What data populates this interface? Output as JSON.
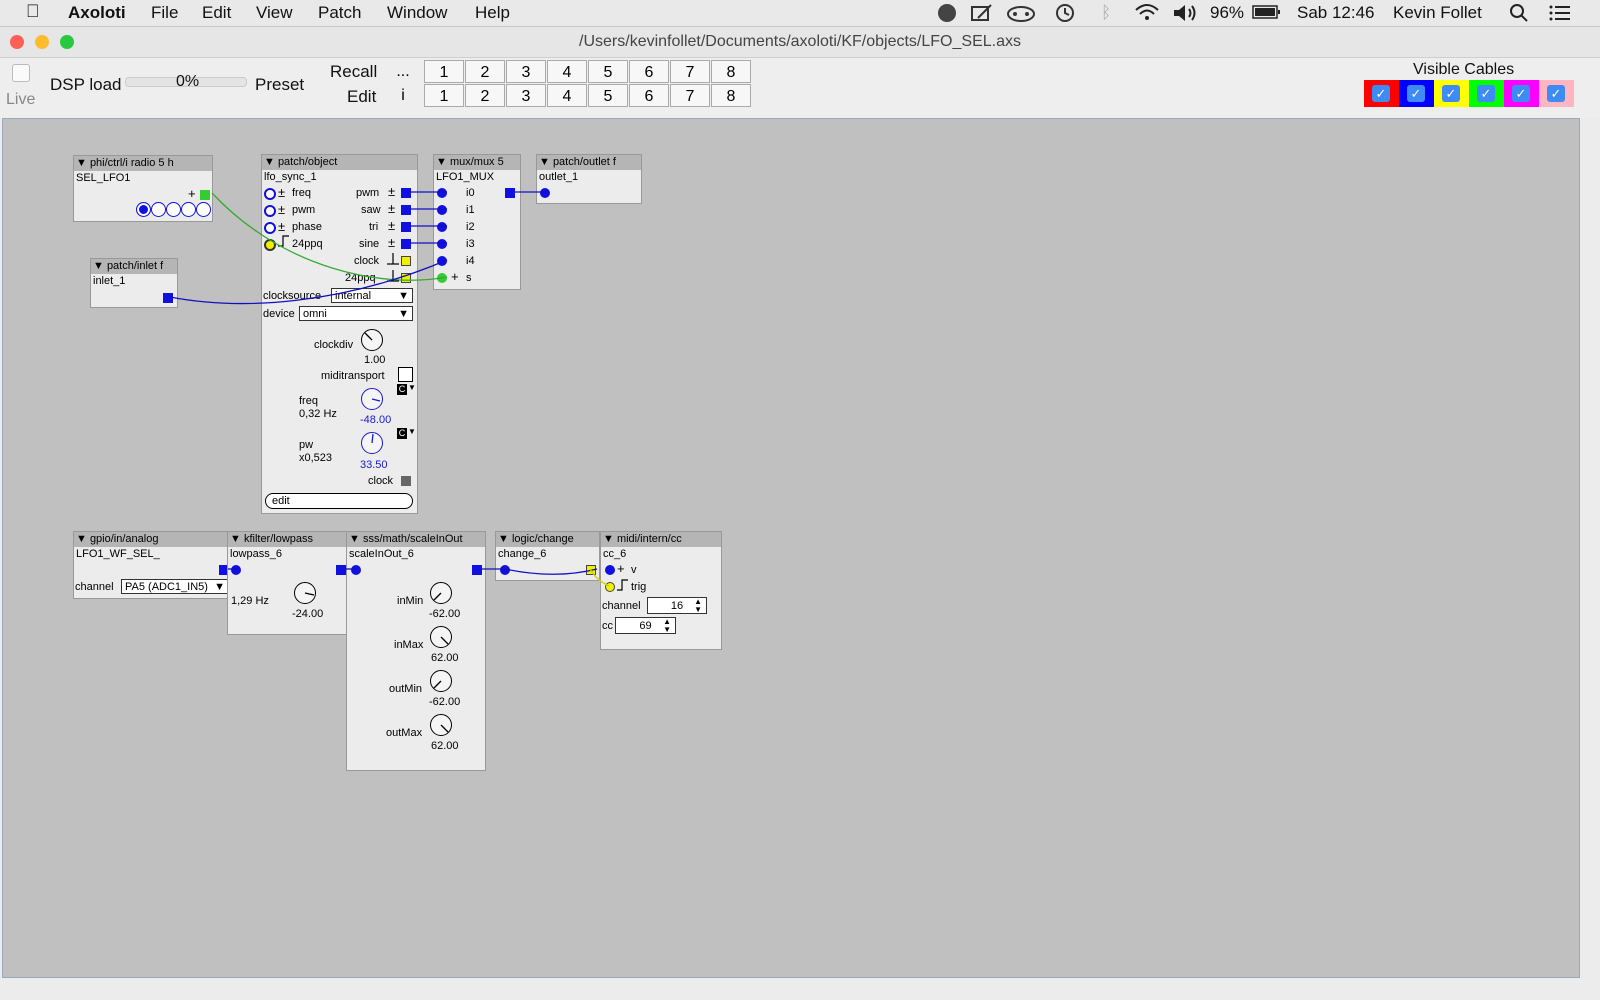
{
  "menubar": {
    "app": "Axoloti",
    "items": [
      "File",
      "Edit",
      "View",
      "Patch",
      "Window",
      "Help"
    ],
    "battery": "96%",
    "clock": "Sab 12:46",
    "user": "Kevin Follet"
  },
  "window": {
    "title": "/Users/kevinfollet/Documents/axoloti/KF/objects/LFO_SEL.axs"
  },
  "toolbar": {
    "live": "Live",
    "dsp_load": "DSP load",
    "dsp_value": "0%",
    "preset": "Preset",
    "recall": "Recall",
    "edit": "Edit",
    "recall_cells": [
      "...",
      "1",
      "2",
      "3",
      "4",
      "5",
      "6",
      "7",
      "8"
    ],
    "edit_cells": [
      "i",
      "1",
      "2",
      "3",
      "4",
      "5",
      "6",
      "7",
      "8"
    ],
    "visible_cables": "Visible Cables",
    "cable_colors": [
      "#ff0000",
      "#0000ff",
      "#ffff00",
      "#00ff00",
      "#ff00ff",
      "#ffb6c1"
    ],
    "check_mark": "✓"
  },
  "objects": {
    "radio": {
      "header": "▼ phi/ctrl/i radio 5 h",
      "instance": "SEL_LFO1",
      "plus": "+"
    },
    "inlet": {
      "header": "▼ patch/inlet f",
      "instance": "inlet_1"
    },
    "lfo": {
      "header": "▼ patch/object",
      "instance": "lfo_sync_1",
      "inputs": [
        "freq",
        "pwm",
        "phase",
        "24ppq"
      ],
      "outputs": [
        "pwm",
        "saw",
        "tri",
        "sine",
        "clock",
        "24ppq"
      ],
      "pm": "±",
      "clocksource_label": "clocksource",
      "clocksource_value": "internal",
      "device_label": "device",
      "device_value": "omni",
      "clockdiv_label": "clockdiv",
      "clockdiv_value": "1.00",
      "miditransport_label": "miditransport",
      "freq_label": "freq",
      "freq_hz": "0,32 Hz",
      "freq_value": "-48.00",
      "pw_label": "pw",
      "pw_x": "x0,523",
      "pw_value": "33.50",
      "clock_label": "clock",
      "edit_label": "edit",
      "c_label": "C"
    },
    "mux": {
      "header": "▼ mux/mux 5",
      "instance": "LFO1_MUX",
      "inputs": [
        "i0",
        "i1",
        "i2",
        "i3",
        "i4",
        "s"
      ],
      "plus": "+"
    },
    "outlet": {
      "header": "▼ patch/outlet f",
      "instance": "outlet_1"
    },
    "gpio": {
      "header": "▼ gpio/in/analog",
      "instance": "LFO1_WF_SEL_",
      "channel_label": "channel",
      "channel_value": "PA5 (ADC1_IN5)"
    },
    "lowpass": {
      "header": "▼ kfilter/lowpass",
      "instance": "lowpass_6",
      "hz": "1,29 Hz",
      "value": "-24.00"
    },
    "scale": {
      "header": "▼ sss/math/scaleInOut",
      "instance": "scaleInOut_6",
      "knobs": [
        {
          "label": "inMin",
          "value": "-62.00"
        },
        {
          "label": "inMax",
          "value": "62.00"
        },
        {
          "label": "outMin",
          "value": "-62.00"
        },
        {
          "label": "outMax",
          "value": "62.00"
        }
      ]
    },
    "change": {
      "header": "▼ logic/change",
      "instance": "change_6"
    },
    "cc": {
      "header": "▼ midi/intern/cc",
      "instance": "cc_6",
      "v": "v",
      "trig": "trig",
      "plus": "+",
      "channel_label": "channel",
      "channel_value": "16",
      "cc_label": "cc",
      "cc_value": "69"
    }
  },
  "colors": {
    "port_blue": "#1010e0",
    "param_blue": "#1a1ad0",
    "cable_green": "#33aa33",
    "port_green": "#33cc33",
    "port_yellow": "#f0f000"
  }
}
